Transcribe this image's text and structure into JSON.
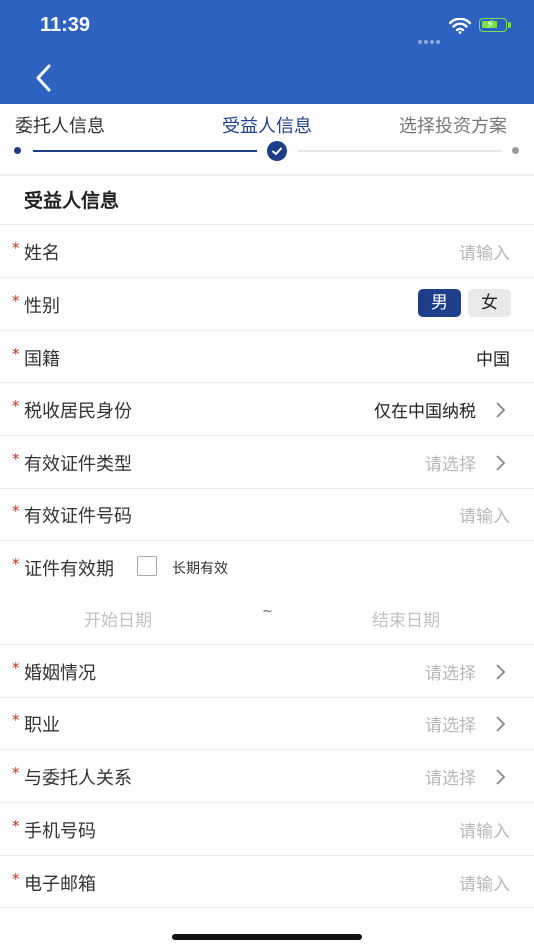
{
  "status_bar": {
    "time": "11:39"
  },
  "steps": [
    {
      "label": "委托人信息",
      "state": "done"
    },
    {
      "label": "受益人信息",
      "state": "active"
    },
    {
      "label": "选择投资方案",
      "state": "todo"
    }
  ],
  "section_title": "受益人信息",
  "form": {
    "required_mark": "*",
    "name": {
      "label": "姓名",
      "placeholder": "请输入"
    },
    "gender": {
      "label": "性别",
      "options": [
        "男",
        "女"
      ],
      "selected": "男"
    },
    "nationality": {
      "label": "国籍",
      "value": "中国"
    },
    "tax_residency": {
      "label": "税收居民身份",
      "value": "仅在中国纳税"
    },
    "id_type": {
      "label": "有效证件类型",
      "placeholder": "请选择"
    },
    "id_number": {
      "label": "有效证件号码",
      "placeholder": "请输入"
    },
    "id_validity": {
      "label": "证件有效期",
      "long_term_label": "长期有效",
      "start_placeholder": "开始日期",
      "separator": "~",
      "end_placeholder": "结束日期"
    },
    "marital_status": {
      "label": "婚姻情况",
      "placeholder": "请选择"
    },
    "occupation": {
      "label": "职业",
      "placeholder": "请选择"
    },
    "relationship": {
      "label": "与委托人关系",
      "placeholder": "请选择"
    },
    "phone": {
      "label": "手机号码",
      "placeholder": "请输入"
    },
    "email": {
      "label": "电子邮箱",
      "placeholder": "请输入"
    }
  },
  "colors": {
    "header": "#2d62c0",
    "accent": "#1d3f8a",
    "required": "#d9261c",
    "placeholder": "#b7b7b7"
  },
  "icons": [
    "back-chevron-icon",
    "wifi-icon",
    "battery-charging-icon",
    "check-icon",
    "chevron-right-icon"
  ]
}
